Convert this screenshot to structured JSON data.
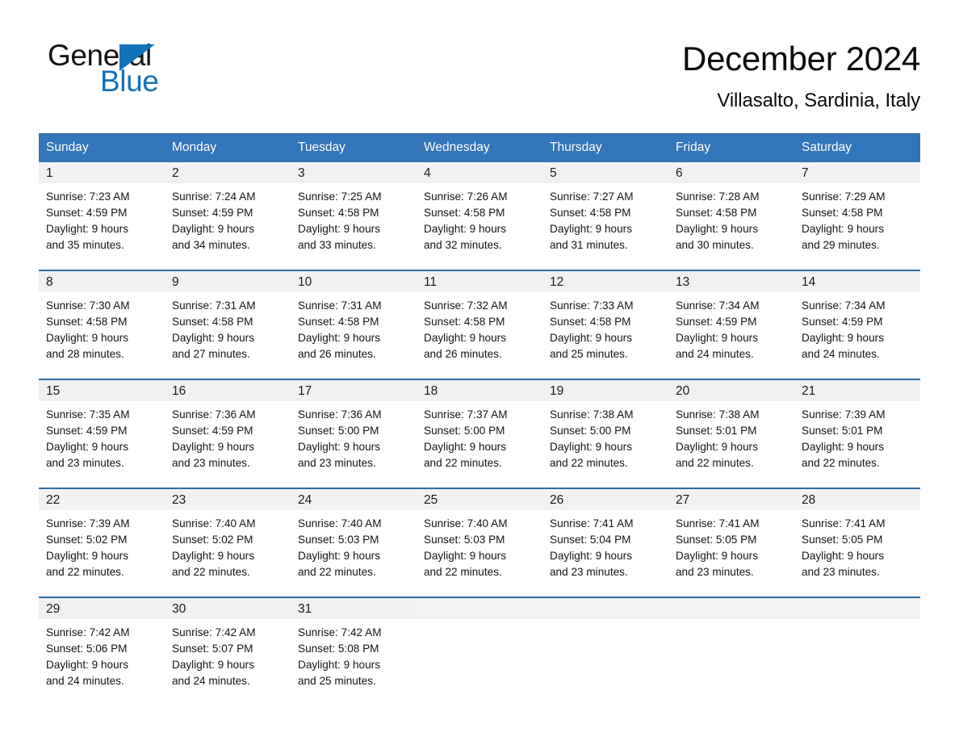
{
  "brand": {
    "name_part1": "General",
    "name_part2": "Blue",
    "accent_color": "#1272bc",
    "triangle_icon": "triangle-icon"
  },
  "header": {
    "title": "December 2024",
    "location": "Villasalto, Sardinia, Italy",
    "header_bg_color": "#3275b8"
  },
  "calendar": {
    "weekdays": [
      "Sunday",
      "Monday",
      "Tuesday",
      "Wednesday",
      "Thursday",
      "Friday",
      "Saturday"
    ],
    "weeks": [
      [
        {
          "day": "1",
          "sunrise": "Sunrise: 7:23 AM",
          "sunset": "Sunset: 4:59 PM",
          "daylight_line1": "Daylight: 9 hours",
          "daylight_line2": "and 35 minutes."
        },
        {
          "day": "2",
          "sunrise": "Sunrise: 7:24 AM",
          "sunset": "Sunset: 4:59 PM",
          "daylight_line1": "Daylight: 9 hours",
          "daylight_line2": "and 34 minutes."
        },
        {
          "day": "3",
          "sunrise": "Sunrise: 7:25 AM",
          "sunset": "Sunset: 4:58 PM",
          "daylight_line1": "Daylight: 9 hours",
          "daylight_line2": "and 33 minutes."
        },
        {
          "day": "4",
          "sunrise": "Sunrise: 7:26 AM",
          "sunset": "Sunset: 4:58 PM",
          "daylight_line1": "Daylight: 9 hours",
          "daylight_line2": "and 32 minutes."
        },
        {
          "day": "5",
          "sunrise": "Sunrise: 7:27 AM",
          "sunset": "Sunset: 4:58 PM",
          "daylight_line1": "Daylight: 9 hours",
          "daylight_line2": "and 31 minutes."
        },
        {
          "day": "6",
          "sunrise": "Sunrise: 7:28 AM",
          "sunset": "Sunset: 4:58 PM",
          "daylight_line1": "Daylight: 9 hours",
          "daylight_line2": "and 30 minutes."
        },
        {
          "day": "7",
          "sunrise": "Sunrise: 7:29 AM",
          "sunset": "Sunset: 4:58 PM",
          "daylight_line1": "Daylight: 9 hours",
          "daylight_line2": "and 29 minutes."
        }
      ],
      [
        {
          "day": "8",
          "sunrise": "Sunrise: 7:30 AM",
          "sunset": "Sunset: 4:58 PM",
          "daylight_line1": "Daylight: 9 hours",
          "daylight_line2": "and 28 minutes."
        },
        {
          "day": "9",
          "sunrise": "Sunrise: 7:31 AM",
          "sunset": "Sunset: 4:58 PM",
          "daylight_line1": "Daylight: 9 hours",
          "daylight_line2": "and 27 minutes."
        },
        {
          "day": "10",
          "sunrise": "Sunrise: 7:31 AM",
          "sunset": "Sunset: 4:58 PM",
          "daylight_line1": "Daylight: 9 hours",
          "daylight_line2": "and 26 minutes."
        },
        {
          "day": "11",
          "sunrise": "Sunrise: 7:32 AM",
          "sunset": "Sunset: 4:58 PM",
          "daylight_line1": "Daylight: 9 hours",
          "daylight_line2": "and 26 minutes."
        },
        {
          "day": "12",
          "sunrise": "Sunrise: 7:33 AM",
          "sunset": "Sunset: 4:58 PM",
          "daylight_line1": "Daylight: 9 hours",
          "daylight_line2": "and 25 minutes."
        },
        {
          "day": "13",
          "sunrise": "Sunrise: 7:34 AM",
          "sunset": "Sunset: 4:59 PM",
          "daylight_line1": "Daylight: 9 hours",
          "daylight_line2": "and 24 minutes."
        },
        {
          "day": "14",
          "sunrise": "Sunrise: 7:34 AM",
          "sunset": "Sunset: 4:59 PM",
          "daylight_line1": "Daylight: 9 hours",
          "daylight_line2": "and 24 minutes."
        }
      ],
      [
        {
          "day": "15",
          "sunrise": "Sunrise: 7:35 AM",
          "sunset": "Sunset: 4:59 PM",
          "daylight_line1": "Daylight: 9 hours",
          "daylight_line2": "and 23 minutes."
        },
        {
          "day": "16",
          "sunrise": "Sunrise: 7:36 AM",
          "sunset": "Sunset: 4:59 PM",
          "daylight_line1": "Daylight: 9 hours",
          "daylight_line2": "and 23 minutes."
        },
        {
          "day": "17",
          "sunrise": "Sunrise: 7:36 AM",
          "sunset": "Sunset: 5:00 PM",
          "daylight_line1": "Daylight: 9 hours",
          "daylight_line2": "and 23 minutes."
        },
        {
          "day": "18",
          "sunrise": "Sunrise: 7:37 AM",
          "sunset": "Sunset: 5:00 PM",
          "daylight_line1": "Daylight: 9 hours",
          "daylight_line2": "and 22 minutes."
        },
        {
          "day": "19",
          "sunrise": "Sunrise: 7:38 AM",
          "sunset": "Sunset: 5:00 PM",
          "daylight_line1": "Daylight: 9 hours",
          "daylight_line2": "and 22 minutes."
        },
        {
          "day": "20",
          "sunrise": "Sunrise: 7:38 AM",
          "sunset": "Sunset: 5:01 PM",
          "daylight_line1": "Daylight: 9 hours",
          "daylight_line2": "and 22 minutes."
        },
        {
          "day": "21",
          "sunrise": "Sunrise: 7:39 AM",
          "sunset": "Sunset: 5:01 PM",
          "daylight_line1": "Daylight: 9 hours",
          "daylight_line2": "and 22 minutes."
        }
      ],
      [
        {
          "day": "22",
          "sunrise": "Sunrise: 7:39 AM",
          "sunset": "Sunset: 5:02 PM",
          "daylight_line1": "Daylight: 9 hours",
          "daylight_line2": "and 22 minutes."
        },
        {
          "day": "23",
          "sunrise": "Sunrise: 7:40 AM",
          "sunset": "Sunset: 5:02 PM",
          "daylight_line1": "Daylight: 9 hours",
          "daylight_line2": "and 22 minutes."
        },
        {
          "day": "24",
          "sunrise": "Sunrise: 7:40 AM",
          "sunset": "Sunset: 5:03 PM",
          "daylight_line1": "Daylight: 9 hours",
          "daylight_line2": "and 22 minutes."
        },
        {
          "day": "25",
          "sunrise": "Sunrise: 7:40 AM",
          "sunset": "Sunset: 5:03 PM",
          "daylight_line1": "Daylight: 9 hours",
          "daylight_line2": "and 22 minutes."
        },
        {
          "day": "26",
          "sunrise": "Sunrise: 7:41 AM",
          "sunset": "Sunset: 5:04 PM",
          "daylight_line1": "Daylight: 9 hours",
          "daylight_line2": "and 23 minutes."
        },
        {
          "day": "27",
          "sunrise": "Sunrise: 7:41 AM",
          "sunset": "Sunset: 5:05 PM",
          "daylight_line1": "Daylight: 9 hours",
          "daylight_line2": "and 23 minutes."
        },
        {
          "day": "28",
          "sunrise": "Sunrise: 7:41 AM",
          "sunset": "Sunset: 5:05 PM",
          "daylight_line1": "Daylight: 9 hours",
          "daylight_line2": "and 23 minutes."
        }
      ],
      [
        {
          "day": "29",
          "sunrise": "Sunrise: 7:42 AM",
          "sunset": "Sunset: 5:06 PM",
          "daylight_line1": "Daylight: 9 hours",
          "daylight_line2": "and 24 minutes."
        },
        {
          "day": "30",
          "sunrise": "Sunrise: 7:42 AM",
          "sunset": "Sunset: 5:07 PM",
          "daylight_line1": "Daylight: 9 hours",
          "daylight_line2": "and 24 minutes."
        },
        {
          "day": "31",
          "sunrise": "Sunrise: 7:42 AM",
          "sunset": "Sunset: 5:08 PM",
          "daylight_line1": "Daylight: 9 hours",
          "daylight_line2": "and 25 minutes."
        },
        {
          "day": "",
          "sunrise": "",
          "sunset": "",
          "daylight_line1": "",
          "daylight_line2": ""
        },
        {
          "day": "",
          "sunrise": "",
          "sunset": "",
          "daylight_line1": "",
          "daylight_line2": ""
        },
        {
          "day": "",
          "sunrise": "",
          "sunset": "",
          "daylight_line1": "",
          "daylight_line2": ""
        },
        {
          "day": "",
          "sunrise": "",
          "sunset": "",
          "daylight_line1": "",
          "daylight_line2": ""
        }
      ]
    ]
  }
}
